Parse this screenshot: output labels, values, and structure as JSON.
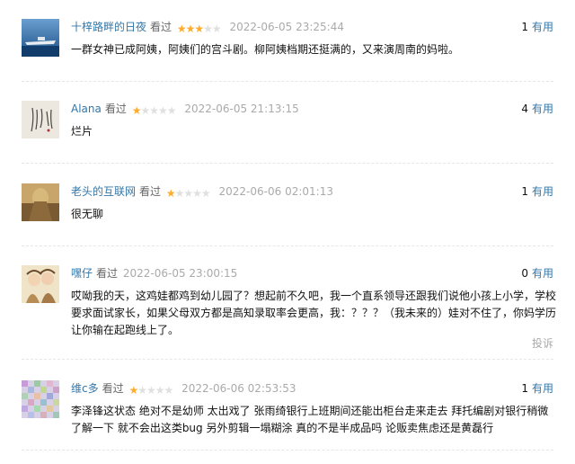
{
  "comments": [
    {
      "user": "十梓路畔的日夜",
      "action": "看过",
      "rating": 3,
      "time": "2022-06-05 23:25:44",
      "votes": "1",
      "vote_label": "有用",
      "text": "一群女神已成阿姨，阿姨们的宫斗剧。柳阿姨档期还挺满的，又来演周南的妈啦。"
    },
    {
      "user": "Alana",
      "action": "看过",
      "rating": 1,
      "time": "2022-06-05 21:13:15",
      "votes": "4",
      "vote_label": "有用",
      "text": "烂片"
    },
    {
      "user": "老头的互联网",
      "action": "看过",
      "rating": 1,
      "time": "2022-06-06 02:01:13",
      "votes": "1",
      "vote_label": "有用",
      "text": "很无聊"
    },
    {
      "user": "嘿仔",
      "action": "看过",
      "rating": 0,
      "time": "2022-06-05 23:00:15",
      "votes": "0",
      "vote_label": "有用",
      "text": "哎呦我的天，这鸡娃都鸡到幼儿园了？想起前不久吧，我一个直系领导还跟我们说他小孩上小学，学校要求面试家长，如果父母双方都是高知录取率会更高，我：？？？（我未来的）娃对不住了，你妈学历让你输在起跑线上了。",
      "report": "投诉"
    },
    {
      "user": "维c多",
      "action": "看过",
      "rating": 1,
      "time": "2022-06-06 02:53:53",
      "votes": "1",
      "vote_label": "有用",
      "text": "李泽锋这状态 绝对不是幼师 太出戏了 张雨绮银行上班期间还能出柜台走来走去 拜托编剧对银行稍微了解一下 就不会出这类bug 另外剪辑一塌糊涂 真的不是半成品吗 论贩卖焦虑还是黄磊行"
    }
  ],
  "colors": {
    "link": "#3377aa",
    "star_on": "#ffac2d",
    "star_off": "#e0e0e0",
    "meta": "#aaaaaa"
  },
  "icons": {
    "star": "star-icon"
  }
}
